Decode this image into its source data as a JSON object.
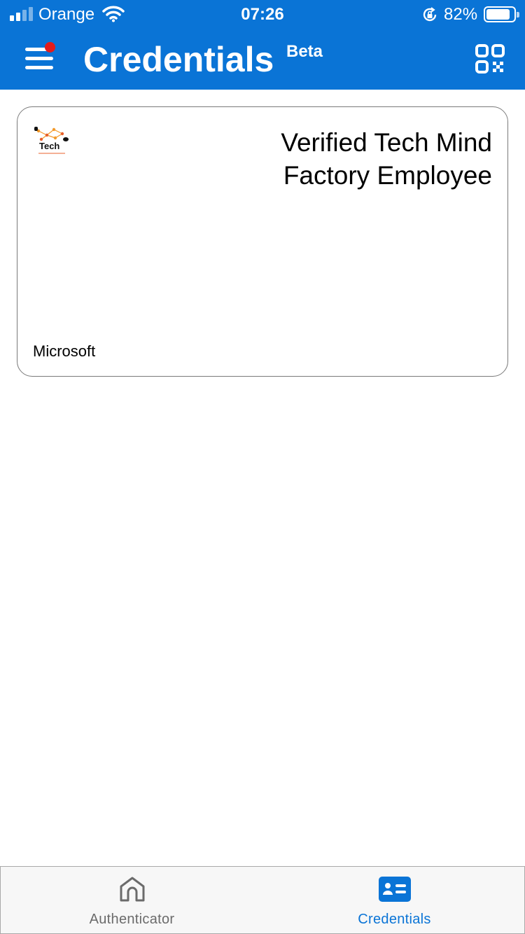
{
  "status_bar": {
    "carrier": "Orange",
    "time": "07:26",
    "battery_percent": "82%",
    "battery_level": 0.82,
    "signal_bars_active": 2,
    "signal_bars_total": 4,
    "icons": [
      "signal-icon",
      "wifi-icon",
      "orientation-lock-icon",
      "battery-icon"
    ]
  },
  "header": {
    "title": "Credentials",
    "badge": "Beta",
    "background_color": "#0a74d6",
    "icons": {
      "menu": "menu-icon",
      "notification": "notification-dot-icon",
      "scan": "qr-code-icon"
    }
  },
  "credential_card": {
    "title": "Verified Tech Mind Factory Employee",
    "issuer": "Microsoft",
    "logo_text": "Tech"
  },
  "tabbar": {
    "tabs": [
      {
        "label": "Authenticator",
        "icon": "home-icon",
        "selected": false
      },
      {
        "label": "Credentials",
        "icon": "id-card-icon",
        "selected": true
      }
    ],
    "accent_color": "#0a74d6",
    "inactive_color": "#6b6b6b"
  }
}
